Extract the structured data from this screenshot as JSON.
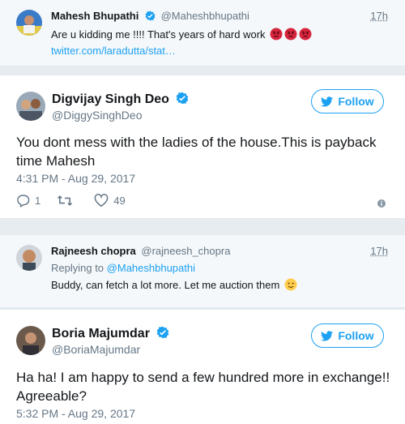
{
  "tweets": [
    {
      "name": "Mahesh Bhupathi",
      "handle": "@Maheshbhupathi",
      "time": "17h",
      "text": "Are u kidding me !!!! That's years of hard work",
      "link": "twitter.com/laradutta/stat…",
      "avatar_icon": "profile-photo"
    },
    {
      "name": "Digvijay Singh Deo",
      "handle": "@DiggySinghDeo",
      "follow_label": "Follow",
      "text": "You dont mess with the ladies of the house.This is payback time Mahesh",
      "date": "4:31 PM - Aug 29, 2017",
      "replies": "1",
      "retweets": "",
      "likes": "49",
      "avatar_icon": "profile-photo"
    },
    {
      "name": "Rajneesh chopra",
      "handle": "@rajneesh_chopra",
      "time": "17h",
      "replying_prefix": "Replying to",
      "replying_to": "@Maheshbhupathi",
      "text": "Buddy, can fetch a lot more. Let me auction them",
      "avatar_icon": "profile-photo"
    },
    {
      "name": "Boria Majumdar",
      "handle": "@BoriaMajumdar",
      "follow_label": "Follow",
      "text": "Ha ha! I am happy to send a few hundred more in exchange!! Agreeable?",
      "date": "5:32 PM - Aug 29, 2017",
      "avatar_icon": "profile-photo"
    }
  ],
  "colors": {
    "accent": "#1da1f2",
    "muted": "#657786",
    "background": "#e6ecf0",
    "angry_emoji": "#d7263d"
  }
}
